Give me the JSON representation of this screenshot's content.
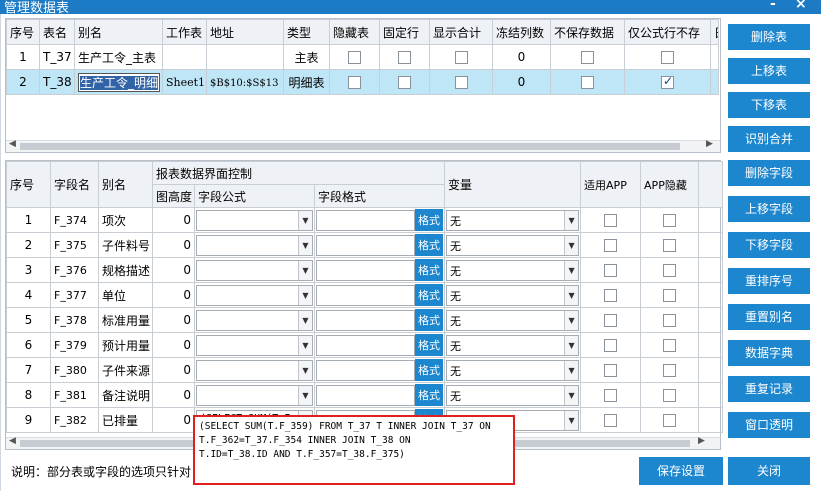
{
  "window": {
    "title": "管理数据表",
    "minimize": "-",
    "close": "×"
  },
  "tables": {
    "headers": [
      "序号",
      "表名",
      "别名",
      "工作表",
      "地址",
      "类型",
      "隐藏表",
      "固定行",
      "显示合计",
      "冻结列数",
      "不保存数据",
      "仅公式行不存",
      "日"
    ],
    "rows": [
      {
        "no": "1",
        "name": "T_37",
        "alias": "生产工令_主表",
        "sheet": "",
        "addr": "",
        "type": "主表",
        "hidden": false,
        "fixed": false,
        "sum": false,
        "freeze": "0",
        "nosave": false,
        "formulaOnly": false
      },
      {
        "no": "2",
        "name": "T_38",
        "alias_pre": "",
        "alias": "生产工令_明细",
        "sheet": "Sheet1",
        "addr": "$B$10:$S$13",
        "type": "明细表",
        "hidden": false,
        "fixed": false,
        "sum": false,
        "freeze": "0",
        "nosave": false,
        "formulaOnly": true
      }
    ]
  },
  "fields": {
    "group_header": "报表数据界面控制",
    "headers": {
      "no": "序号",
      "field": "字段名",
      "alias": "别名",
      "height": "图高度",
      "formula": "字段公式",
      "format": "字段格式",
      "var": "变量",
      "app": "适用APP",
      "apphide": "APP隐藏"
    },
    "format_btn": "格式",
    "rows": [
      {
        "no": "1",
        "field": "F_374",
        "alias": "项次",
        "h": "0",
        "formula": "",
        "var": "无"
      },
      {
        "no": "2",
        "field": "F_375",
        "alias": "子件料号",
        "h": "0",
        "formula": "",
        "var": "无"
      },
      {
        "no": "3",
        "field": "F_376",
        "alias": "规格描述",
        "h": "0",
        "formula": "",
        "var": "无"
      },
      {
        "no": "4",
        "field": "F_377",
        "alias": "单位",
        "h": "0",
        "formula": "",
        "var": "无"
      },
      {
        "no": "5",
        "field": "F_378",
        "alias": "标准用量",
        "h": "0",
        "formula": "",
        "var": "无"
      },
      {
        "no": "6",
        "field": "F_379",
        "alias": "预计用量",
        "h": "0",
        "formula": "",
        "var": "无"
      },
      {
        "no": "7",
        "field": "F_380",
        "alias": "子件来源",
        "h": "0",
        "formula": "",
        "var": "无"
      },
      {
        "no": "8",
        "field": "F_381",
        "alias": "备注说明",
        "h": "0",
        "formula": "",
        "var": "无"
      },
      {
        "no": "9",
        "field": "F_382",
        "alias": "已排量",
        "h": "0",
        "formula": "(SELECT SUM(T.F_",
        "var": "无"
      }
    ]
  },
  "buttons": {
    "delete_table": "删除表",
    "move_up": "上移表",
    "move_down": "下移表",
    "merge": "识别合并",
    "delete_field": "删除字段",
    "up_field": "上移字段",
    "down_field": "下移字段",
    "renumber": "重排序号",
    "reset_alias": "重置别名",
    "dictionary": "数据字典",
    "dup_record": "重复记录",
    "transparent": "窗口透明",
    "save": "保存设置",
    "close": "关闭"
  },
  "note": "说明：部分表或字段的选项只针对",
  "popup_text": "(SELECT SUM(T.F_359) FROM T_37 T INNER JOIN T_37 ON\nT.F_362=T_37.F_354 INNER JOIN T_38 ON\nT.ID=T_38.ID AND T.F_357=T_38.F_375)",
  "colors": {
    "accent": "#1c86cf",
    "selected_row": "#bfe6f6",
    "popup_border": "#e0201e"
  }
}
